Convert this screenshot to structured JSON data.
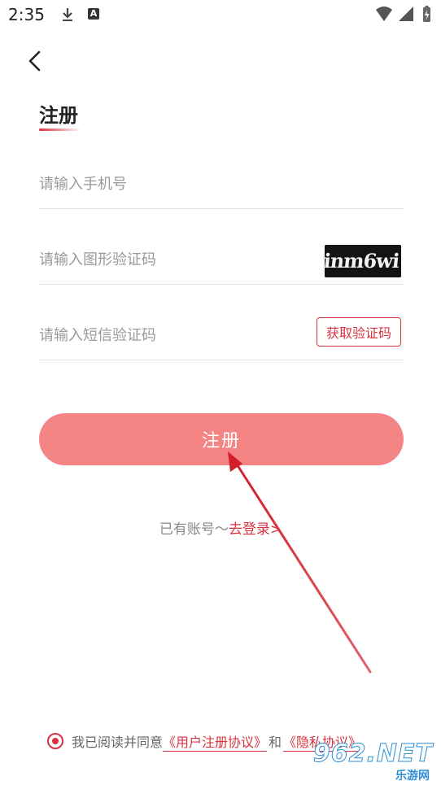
{
  "status_bar": {
    "time": "2:35",
    "icons": [
      "download-icon",
      "a-notification-icon",
      "wifi-icon",
      "signal-icon",
      "battery-icon"
    ]
  },
  "header": {
    "back_icon": "chevron-left-icon",
    "title": "注册"
  },
  "form": {
    "phone": {
      "placeholder": "请输入手机号",
      "value": ""
    },
    "captcha": {
      "placeholder": "请输入图形验证码",
      "value": "",
      "image_text": "inm6wi"
    },
    "sms": {
      "placeholder": "请输入短信验证码",
      "value": "",
      "button_label": "获取验证码"
    },
    "submit_label": "注册"
  },
  "login_prompt": {
    "prefix": "已有账号～",
    "link": "去登录>"
  },
  "agreement": {
    "checked": true,
    "text": "我已阅读并同意",
    "user_agreement": "《用户注册协议》",
    "and": "和",
    "privacy": "《隐私协议》"
  },
  "watermark": {
    "main": "962.NET",
    "sub": "乐游网"
  },
  "colors": {
    "accent": "#d9333f",
    "button_bg": "#f58585",
    "placeholder": "#9a9a9a",
    "divider": "#e3e3e3"
  }
}
